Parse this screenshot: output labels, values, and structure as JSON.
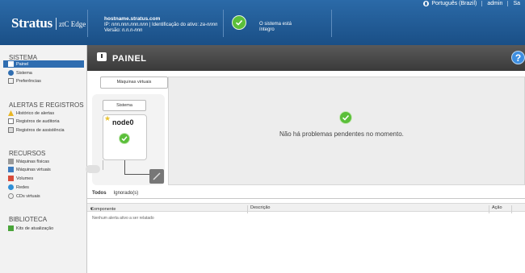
{
  "header": {
    "brand": "Stratus",
    "product": "ztC Edge",
    "hostname": "hostname.stratus.com",
    "ip_line_prefix": "IP:",
    "ip_value": "nnn.nnn.nnn.nnn",
    "asset_label": "| Identificação do ativo:",
    "asset_value": "za-nnnn",
    "version_label": "Versão:",
    "version_value": "n.n.n-nnn",
    "system_status_line1": "O sistema está",
    "system_status_line2": "íntegro",
    "language": "Português (Brazil)",
    "user": "admin",
    "logout": "Sa"
  },
  "sidebar": {
    "sistema": "SISTEMA",
    "painel": "Painel",
    "sistema_item": "Sistema",
    "preferencias": "Preferências",
    "alertas": "ALERTAS E REGISTROS",
    "historico": "Histórico de alertas",
    "auditoria": "Registros de auditoria",
    "assistencia": "Registros de assistência",
    "recursos": "RECURSOS",
    "maquinas_fisicas": "Máquinas físicas",
    "maquinas_virtuais": "Máquinas virtuais",
    "volumes": "Volumes",
    "redes": "Redes",
    "cds": "CDs virtuais",
    "biblioteca": "BIBLIOTECA",
    "kits": "Kits de atualização"
  },
  "panel": {
    "title": "PAINEL",
    "help": "?",
    "vm_button": "Máquinas virtuais",
    "system_button": "Sistema",
    "node_name": "node0",
    "status_message": "Não há problemas pendentes no momento."
  },
  "alerts": {
    "tab_all": "Todos",
    "tab_ignored": "Ignorado(s)",
    "col_component": "Componente",
    "col_description": "Descrição",
    "col_action": "Ação",
    "empty": "Nenhum alerta ativo a ser relatado"
  },
  "colors": {
    "header_blue": "#1a4f86",
    "ok_green": "#5bbf3a",
    "active_nav": "#2f6db0"
  }
}
